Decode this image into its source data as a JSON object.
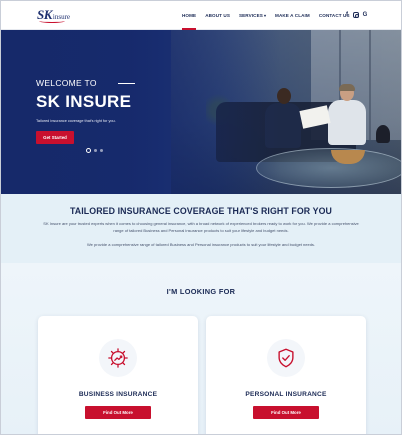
{
  "brand": {
    "logo_sk": "SK",
    "logo_insure": "insure"
  },
  "nav": {
    "items": [
      {
        "label": "HOME"
      },
      {
        "label": "ABOUT US"
      },
      {
        "label": "SERVICES"
      },
      {
        "label": "MAKE A CLAIM"
      },
      {
        "label": "CONTACT US"
      }
    ],
    "services_caret": "▾",
    "active": "HOME"
  },
  "socials": {
    "facebook": "f",
    "google": "G",
    "icons": [
      "facebook-icon",
      "instagram-icon",
      "google-icon"
    ]
  },
  "hero": {
    "welcome": "WELCOME TO",
    "title": "SK INSURE",
    "subtitle": "Tailored insurance coverage that's right for you.",
    "button": "Get Started",
    "slides": 3,
    "active_slide": 1
  },
  "tailored": {
    "title": "TAILORED INSURANCE COVERAGE THAT'S RIGHT FOR YOU",
    "paragraph1": "SK Insure are your trusted experts when it comes to choosing general insurance, with a broad network of experienced brokers ready to work for you. We provide a comprehensive range of tailored Business and Personal insurance products to suit your lifestyle and budget needs.",
    "paragraph2": "We provide a comprehensive range of tailored Business and Personal insurance products to suit your lifestyle and budget needs."
  },
  "looking": {
    "title": "I'M LOOKING FOR",
    "cards": [
      {
        "title": "BUSINESS INSURANCE",
        "button": "Find Out More",
        "icon": "business-growth-icon"
      },
      {
        "title": "PERSONAL INSURANCE",
        "button": "Find Out More",
        "icon": "shield-check-icon"
      }
    ]
  },
  "colors": {
    "accent": "#c8102e",
    "navy": "#1b2a55",
    "hero_blue": "#16296a",
    "section_bg": "#e4f0f7"
  }
}
